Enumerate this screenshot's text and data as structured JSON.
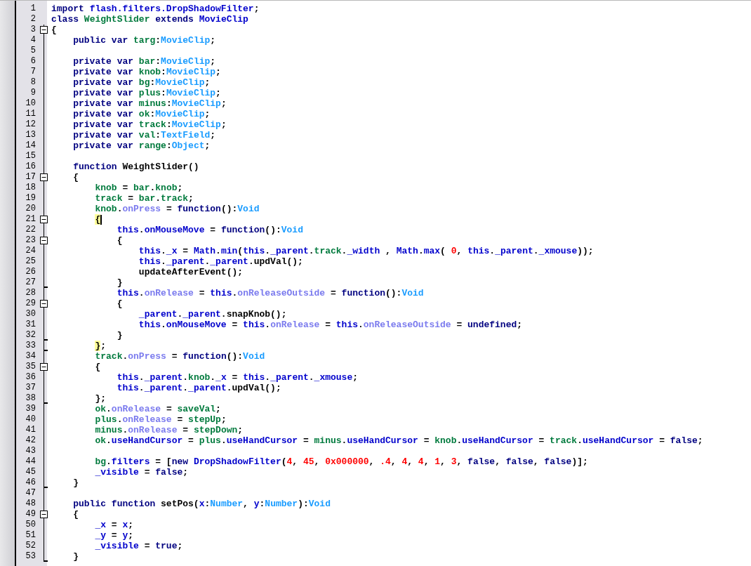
{
  "editor": {
    "lines": [
      {
        "number": "1",
        "tokens": [
          {
            "kind": "keyword",
            "text": "import"
          },
          {
            "kind": "builtin",
            "text": " flash.filters.DropShadowFilter"
          },
          {
            "kind": "plain",
            "text": ";"
          }
        ]
      },
      {
        "number": "2",
        "tokens": [
          {
            "kind": "keyword",
            "text": "class"
          },
          {
            "kind": "identifier",
            "text": " WeightSlider"
          },
          {
            "kind": "keyword",
            "text": " extends"
          },
          {
            "kind": "builtin",
            "text": " MovieClip"
          }
        ]
      },
      {
        "number": "3",
        "collapsible": true,
        "tokens": [
          {
            "kind": "plain",
            "text": "{"
          }
        ]
      },
      {
        "number": "4",
        "tokens": [
          {
            "kind": "keyword",
            "text": "    public var"
          },
          {
            "kind": "identifier",
            "text": " targ"
          },
          {
            "kind": "plain",
            "text": ":"
          },
          {
            "kind": "type",
            "text": "MovieClip"
          },
          {
            "kind": "plain",
            "text": ";"
          }
        ]
      },
      {
        "number": "5"
      },
      {
        "number": "6",
        "tokens": [
          {
            "kind": "keyword",
            "text": "    private var"
          },
          {
            "kind": "identifier",
            "text": " bar"
          },
          {
            "kind": "plain",
            "text": ":"
          },
          {
            "kind": "type",
            "text": "MovieClip"
          },
          {
            "kind": "plain",
            "text": ";"
          }
        ]
      },
      {
        "number": "7",
        "tokens": [
          {
            "kind": "keyword",
            "text": "    private var"
          },
          {
            "kind": "identifier",
            "text": " knob"
          },
          {
            "kind": "plain",
            "text": ":"
          },
          {
            "kind": "type",
            "text": "MovieClip"
          },
          {
            "kind": "plain",
            "text": ";"
          }
        ]
      },
      {
        "number": "8",
        "tokens": [
          {
            "kind": "keyword",
            "text": "    private var"
          },
          {
            "kind": "identifier",
            "text": " bg"
          },
          {
            "kind": "plain",
            "text": ":"
          },
          {
            "kind": "type",
            "text": "MovieClip"
          },
          {
            "kind": "plain",
            "text": ";"
          }
        ]
      },
      {
        "number": "9",
        "tokens": [
          {
            "kind": "keyword",
            "text": "    private var"
          },
          {
            "kind": "identifier",
            "text": " plus"
          },
          {
            "kind": "plain",
            "text": ":"
          },
          {
            "kind": "type",
            "text": "MovieClip"
          },
          {
            "kind": "plain",
            "text": ";"
          }
        ]
      },
      {
        "number": "10",
        "tokens": [
          {
            "kind": "keyword",
            "text": "    private var"
          },
          {
            "kind": "identifier",
            "text": " minus"
          },
          {
            "kind": "plain",
            "text": ":"
          },
          {
            "kind": "type",
            "text": "MovieClip"
          },
          {
            "kind": "plain",
            "text": ";"
          }
        ]
      },
      {
        "number": "11",
        "tokens": [
          {
            "kind": "keyword",
            "text": "    private var"
          },
          {
            "kind": "identifier",
            "text": " ok"
          },
          {
            "kind": "plain",
            "text": ":"
          },
          {
            "kind": "type",
            "text": "MovieClip"
          },
          {
            "kind": "plain",
            "text": ";"
          }
        ]
      },
      {
        "number": "12",
        "tokens": [
          {
            "kind": "keyword",
            "text": "    private var"
          },
          {
            "kind": "identifier",
            "text": " track"
          },
          {
            "kind": "plain",
            "text": ":"
          },
          {
            "kind": "type",
            "text": "MovieClip"
          },
          {
            "kind": "plain",
            "text": ";"
          }
        ]
      },
      {
        "number": "13",
        "tokens": [
          {
            "kind": "keyword",
            "text": "    private var"
          },
          {
            "kind": "identifier",
            "text": " val"
          },
          {
            "kind": "plain",
            "text": ":"
          },
          {
            "kind": "type",
            "text": "TextField"
          },
          {
            "kind": "plain",
            "text": ";"
          }
        ]
      },
      {
        "number": "14",
        "tokens": [
          {
            "kind": "keyword",
            "text": "    private var"
          },
          {
            "kind": "identifier",
            "text": " range"
          },
          {
            "kind": "plain",
            "text": ":"
          },
          {
            "kind": "type",
            "text": "Object"
          },
          {
            "kind": "plain",
            "text": ";"
          }
        ]
      },
      {
        "number": "15"
      },
      {
        "number": "16",
        "tokens": [
          {
            "kind": "keyword",
            "text": "    function"
          },
          {
            "kind": "plain",
            "text": " WeightSlider()"
          }
        ]
      },
      {
        "number": "17",
        "collapsible": true,
        "tokens": [
          {
            "kind": "plain",
            "text": "    {"
          }
        ]
      },
      {
        "number": "18",
        "tokens": [
          {
            "kind": "identifier",
            "text": "        knob"
          },
          {
            "kind": "plain",
            "text": " = "
          },
          {
            "kind": "identifier",
            "text": "bar"
          },
          {
            "kind": "plain",
            "text": "."
          },
          {
            "kind": "identifier",
            "text": "knob"
          },
          {
            "kind": "plain",
            "text": ";"
          }
        ]
      },
      {
        "number": "19",
        "tokens": [
          {
            "kind": "identifier",
            "text": "        track"
          },
          {
            "kind": "plain",
            "text": " = "
          },
          {
            "kind": "identifier",
            "text": "bar"
          },
          {
            "kind": "plain",
            "text": "."
          },
          {
            "kind": "identifier",
            "text": "track"
          },
          {
            "kind": "plain",
            "text": ";"
          }
        ]
      },
      {
        "number": "20",
        "tokens": [
          {
            "kind": "identifier",
            "text": "        knob"
          },
          {
            "kind": "plain",
            "text": "."
          },
          {
            "kind": "event",
            "text": "onPress"
          },
          {
            "kind": "plain",
            "text": " = "
          },
          {
            "kind": "keyword",
            "text": "function"
          },
          {
            "kind": "plain",
            "text": "():"
          },
          {
            "kind": "type",
            "text": "Void"
          }
        ]
      },
      {
        "number": "21",
        "collapsible": true,
        "caret": true,
        "tokens": [
          {
            "kind": "match",
            "text": "        {"
          }
        ]
      },
      {
        "number": "22",
        "tokens": [
          {
            "kind": "builtin",
            "text": "            this"
          },
          {
            "kind": "plain",
            "text": "."
          },
          {
            "kind": "builtin",
            "text": "onMouseMove"
          },
          {
            "kind": "plain",
            "text": " = "
          },
          {
            "kind": "keyword",
            "text": "function"
          },
          {
            "kind": "plain",
            "text": "():"
          },
          {
            "kind": "type",
            "text": "Void"
          }
        ]
      },
      {
        "number": "23",
        "collapsible": true,
        "tokens": [
          {
            "kind": "plain",
            "text": "            {"
          }
        ]
      },
      {
        "number": "24",
        "tokens": [
          {
            "kind": "builtin",
            "text": "                this"
          },
          {
            "kind": "plain",
            "text": "."
          },
          {
            "kind": "builtin",
            "text": "_x"
          },
          {
            "kind": "plain",
            "text": " = "
          },
          {
            "kind": "builtin",
            "text": "Math"
          },
          {
            "kind": "plain",
            "text": "."
          },
          {
            "kind": "builtin",
            "text": "min"
          },
          {
            "kind": "plain",
            "text": "("
          },
          {
            "kind": "builtin",
            "text": "this"
          },
          {
            "kind": "plain",
            "text": "."
          },
          {
            "kind": "builtin",
            "text": "_parent"
          },
          {
            "kind": "plain",
            "text": "."
          },
          {
            "kind": "identifier",
            "text": "track"
          },
          {
            "kind": "plain",
            "text": "."
          },
          {
            "kind": "builtin",
            "text": "_width"
          },
          {
            "kind": "plain",
            "text": " , "
          },
          {
            "kind": "builtin",
            "text": "Math"
          },
          {
            "kind": "plain",
            "text": "."
          },
          {
            "kind": "builtin",
            "text": "max"
          },
          {
            "kind": "plain",
            "text": "( "
          },
          {
            "kind": "number",
            "text": "0"
          },
          {
            "kind": "plain",
            "text": ", "
          },
          {
            "kind": "builtin",
            "text": "this"
          },
          {
            "kind": "plain",
            "text": "."
          },
          {
            "kind": "builtin",
            "text": "_parent"
          },
          {
            "kind": "plain",
            "text": "."
          },
          {
            "kind": "builtin",
            "text": "_xmouse"
          },
          {
            "kind": "plain",
            "text": "));"
          }
        ]
      },
      {
        "number": "25",
        "tokens": [
          {
            "kind": "builtin",
            "text": "                this"
          },
          {
            "kind": "plain",
            "text": "."
          },
          {
            "kind": "builtin",
            "text": "_parent"
          },
          {
            "kind": "plain",
            "text": "."
          },
          {
            "kind": "builtin",
            "text": "_parent"
          },
          {
            "kind": "plain",
            "text": ".updVal();"
          }
        ]
      },
      {
        "number": "26",
        "tokens": [
          {
            "kind": "plain",
            "text": "                updateAfterEvent();"
          }
        ]
      },
      {
        "number": "27",
        "block_end": true,
        "tokens": [
          {
            "kind": "plain",
            "text": "            }"
          }
        ]
      },
      {
        "number": "28",
        "tokens": [
          {
            "kind": "builtin",
            "text": "            this"
          },
          {
            "kind": "plain",
            "text": "."
          },
          {
            "kind": "event",
            "text": "onRelease"
          },
          {
            "kind": "plain",
            "text": " = "
          },
          {
            "kind": "builtin",
            "text": "this"
          },
          {
            "kind": "plain",
            "text": "."
          },
          {
            "kind": "event",
            "text": "onReleaseOutside"
          },
          {
            "kind": "plain",
            "text": " = "
          },
          {
            "kind": "keyword",
            "text": "function"
          },
          {
            "kind": "plain",
            "text": "():"
          },
          {
            "kind": "type",
            "text": "Void"
          }
        ]
      },
      {
        "number": "29",
        "collapsible": true,
        "tokens": [
          {
            "kind": "plain",
            "text": "            {"
          }
        ]
      },
      {
        "number": "30",
        "tokens": [
          {
            "kind": "builtin",
            "text": "                _parent"
          },
          {
            "kind": "plain",
            "text": "."
          },
          {
            "kind": "builtin",
            "text": "_parent"
          },
          {
            "kind": "plain",
            "text": ".snapKnob();"
          }
        ]
      },
      {
        "number": "31",
        "tokens": [
          {
            "kind": "builtin",
            "text": "                this"
          },
          {
            "kind": "plain",
            "text": "."
          },
          {
            "kind": "builtin",
            "text": "onMouseMove"
          },
          {
            "kind": "plain",
            "text": " = "
          },
          {
            "kind": "builtin",
            "text": "this"
          },
          {
            "kind": "plain",
            "text": "."
          },
          {
            "kind": "event",
            "text": "onRelease"
          },
          {
            "kind": "plain",
            "text": " = "
          },
          {
            "kind": "builtin",
            "text": "this"
          },
          {
            "kind": "plain",
            "text": "."
          },
          {
            "kind": "event",
            "text": "onReleaseOutside"
          },
          {
            "kind": "plain",
            "text": " = "
          },
          {
            "kind": "keyword",
            "text": "undefined"
          },
          {
            "kind": "plain",
            "text": ";"
          }
        ]
      },
      {
        "number": "32",
        "block_end": true,
        "tokens": [
          {
            "kind": "plain",
            "text": "            }"
          }
        ]
      },
      {
        "number": "33",
        "block_end": true,
        "tokens": [
          {
            "kind": "match",
            "text": "        }"
          },
          {
            "kind": "plain",
            "text": ";"
          }
        ]
      },
      {
        "number": "34",
        "tokens": [
          {
            "kind": "identifier",
            "text": "        track"
          },
          {
            "kind": "plain",
            "text": "."
          },
          {
            "kind": "event",
            "text": "onPress"
          },
          {
            "kind": "plain",
            "text": " = "
          },
          {
            "kind": "keyword",
            "text": "function"
          },
          {
            "kind": "plain",
            "text": "():"
          },
          {
            "kind": "type",
            "text": "Void"
          }
        ]
      },
      {
        "number": "35",
        "collapsible": true,
        "tokens": [
          {
            "kind": "plain",
            "text": "        {"
          }
        ]
      },
      {
        "number": "36",
        "tokens": [
          {
            "kind": "builtin",
            "text": "            this"
          },
          {
            "kind": "plain",
            "text": "."
          },
          {
            "kind": "builtin",
            "text": "_parent"
          },
          {
            "kind": "plain",
            "text": "."
          },
          {
            "kind": "identifier",
            "text": "knob"
          },
          {
            "kind": "plain",
            "text": "."
          },
          {
            "kind": "builtin",
            "text": "_x"
          },
          {
            "kind": "plain",
            "text": " = "
          },
          {
            "kind": "builtin",
            "text": "this"
          },
          {
            "kind": "plain",
            "text": "."
          },
          {
            "kind": "builtin",
            "text": "_parent"
          },
          {
            "kind": "plain",
            "text": "."
          },
          {
            "kind": "builtin",
            "text": "_xmouse"
          },
          {
            "kind": "plain",
            "text": ";"
          }
        ]
      },
      {
        "number": "37",
        "tokens": [
          {
            "kind": "builtin",
            "text": "            this"
          },
          {
            "kind": "plain",
            "text": "."
          },
          {
            "kind": "builtin",
            "text": "_parent"
          },
          {
            "kind": "plain",
            "text": "."
          },
          {
            "kind": "builtin",
            "text": "_parent"
          },
          {
            "kind": "plain",
            "text": ".updVal();"
          }
        ]
      },
      {
        "number": "38",
        "block_end": true,
        "tokens": [
          {
            "kind": "plain",
            "text": "        };"
          }
        ]
      },
      {
        "number": "39",
        "tokens": [
          {
            "kind": "identifier",
            "text": "        ok"
          },
          {
            "kind": "plain",
            "text": "."
          },
          {
            "kind": "event",
            "text": "onRelease"
          },
          {
            "kind": "plain",
            "text": " = "
          },
          {
            "kind": "identifier",
            "text": "saveVal"
          },
          {
            "kind": "plain",
            "text": ";"
          }
        ]
      },
      {
        "number": "40",
        "tokens": [
          {
            "kind": "identifier",
            "text": "        plus"
          },
          {
            "kind": "plain",
            "text": "."
          },
          {
            "kind": "event",
            "text": "onRelease"
          },
          {
            "kind": "plain",
            "text": " = "
          },
          {
            "kind": "identifier",
            "text": "stepUp"
          },
          {
            "kind": "plain",
            "text": ";"
          }
        ]
      },
      {
        "number": "41",
        "tokens": [
          {
            "kind": "identifier",
            "text": "        minus"
          },
          {
            "kind": "plain",
            "text": "."
          },
          {
            "kind": "event",
            "text": "onRelease"
          },
          {
            "kind": "plain",
            "text": " = "
          },
          {
            "kind": "identifier",
            "text": "stepDown"
          },
          {
            "kind": "plain",
            "text": ";"
          }
        ]
      },
      {
        "number": "42",
        "tokens": [
          {
            "kind": "identifier",
            "text": "        ok"
          },
          {
            "kind": "plain",
            "text": "."
          },
          {
            "kind": "builtin",
            "text": "useHandCursor"
          },
          {
            "kind": "plain",
            "text": " = "
          },
          {
            "kind": "identifier",
            "text": "plus"
          },
          {
            "kind": "plain",
            "text": "."
          },
          {
            "kind": "builtin",
            "text": "useHandCursor"
          },
          {
            "kind": "plain",
            "text": " = "
          },
          {
            "kind": "identifier",
            "text": "minus"
          },
          {
            "kind": "plain",
            "text": "."
          },
          {
            "kind": "builtin",
            "text": "useHandCursor"
          },
          {
            "kind": "plain",
            "text": " = "
          },
          {
            "kind": "identifier",
            "text": "knob"
          },
          {
            "kind": "plain",
            "text": "."
          },
          {
            "kind": "builtin",
            "text": "useHandCursor"
          },
          {
            "kind": "plain",
            "text": " = "
          },
          {
            "kind": "identifier",
            "text": "track"
          },
          {
            "kind": "plain",
            "text": "."
          },
          {
            "kind": "builtin",
            "text": "useHandCursor"
          },
          {
            "kind": "plain",
            "text": " = "
          },
          {
            "kind": "keyword",
            "text": "false"
          },
          {
            "kind": "plain",
            "text": ";"
          }
        ]
      },
      {
        "number": "43"
      },
      {
        "number": "44",
        "tokens": [
          {
            "kind": "identifier",
            "text": "        bg"
          },
          {
            "kind": "plain",
            "text": "."
          },
          {
            "kind": "builtin",
            "text": "filters"
          },
          {
            "kind": "plain",
            "text": " = ["
          },
          {
            "kind": "keyword",
            "text": "new"
          },
          {
            "kind": "builtin",
            "text": " DropShadowFilter"
          },
          {
            "kind": "plain",
            "text": "("
          },
          {
            "kind": "number",
            "text": "4"
          },
          {
            "kind": "plain",
            "text": ", "
          },
          {
            "kind": "number",
            "text": "45"
          },
          {
            "kind": "plain",
            "text": ", "
          },
          {
            "kind": "number",
            "text": "0x000000"
          },
          {
            "kind": "plain",
            "text": ", "
          },
          {
            "kind": "number",
            "text": ".4"
          },
          {
            "kind": "plain",
            "text": ", "
          },
          {
            "kind": "number",
            "text": "4"
          },
          {
            "kind": "plain",
            "text": ", "
          },
          {
            "kind": "number",
            "text": "4"
          },
          {
            "kind": "plain",
            "text": ", "
          },
          {
            "kind": "number",
            "text": "1"
          },
          {
            "kind": "plain",
            "text": ", "
          },
          {
            "kind": "number",
            "text": "3"
          },
          {
            "kind": "plain",
            "text": ", "
          },
          {
            "kind": "keyword",
            "text": "false"
          },
          {
            "kind": "plain",
            "text": ", "
          },
          {
            "kind": "keyword",
            "text": "false"
          },
          {
            "kind": "plain",
            "text": ", "
          },
          {
            "kind": "keyword",
            "text": "false"
          },
          {
            "kind": "plain",
            "text": ")];"
          }
        ]
      },
      {
        "number": "45",
        "tokens": [
          {
            "kind": "builtin",
            "text": "        _visible"
          },
          {
            "kind": "plain",
            "text": " = "
          },
          {
            "kind": "keyword",
            "text": "false"
          },
          {
            "kind": "plain",
            "text": ";"
          }
        ]
      },
      {
        "number": "46",
        "block_end": true,
        "tokens": [
          {
            "kind": "plain",
            "text": "    }"
          }
        ]
      },
      {
        "number": "47"
      },
      {
        "number": "48",
        "tokens": [
          {
            "kind": "keyword",
            "text": "    public function"
          },
          {
            "kind": "plain",
            "text": " setPos("
          },
          {
            "kind": "builtin",
            "text": "x"
          },
          {
            "kind": "plain",
            "text": ":"
          },
          {
            "kind": "type",
            "text": "Number"
          },
          {
            "kind": "plain",
            "text": ", "
          },
          {
            "kind": "builtin",
            "text": "y"
          },
          {
            "kind": "plain",
            "text": ":"
          },
          {
            "kind": "type",
            "text": "Number"
          },
          {
            "kind": "plain",
            "text": "):"
          },
          {
            "kind": "type",
            "text": "Void"
          }
        ]
      },
      {
        "number": "49",
        "collapsible": true,
        "tokens": [
          {
            "kind": "plain",
            "text": "    {"
          }
        ]
      },
      {
        "number": "50",
        "tokens": [
          {
            "kind": "builtin",
            "text": "        _x"
          },
          {
            "kind": "plain",
            "text": " = "
          },
          {
            "kind": "builtin",
            "text": "x"
          },
          {
            "kind": "plain",
            "text": ";"
          }
        ]
      },
      {
        "number": "51",
        "tokens": [
          {
            "kind": "builtin",
            "text": "        _y"
          },
          {
            "kind": "plain",
            "text": " = "
          },
          {
            "kind": "builtin",
            "text": "y"
          },
          {
            "kind": "plain",
            "text": ";"
          }
        ]
      },
      {
        "number": "52",
        "tokens": [
          {
            "kind": "builtin",
            "text": "        _visible"
          },
          {
            "kind": "plain",
            "text": " = "
          },
          {
            "kind": "keyword",
            "text": "true"
          },
          {
            "kind": "plain",
            "text": ";"
          }
        ]
      },
      {
        "number": "53",
        "block_end": true,
        "tokens": [
          {
            "kind": "plain",
            "text": "    }"
          }
        ]
      }
    ]
  }
}
